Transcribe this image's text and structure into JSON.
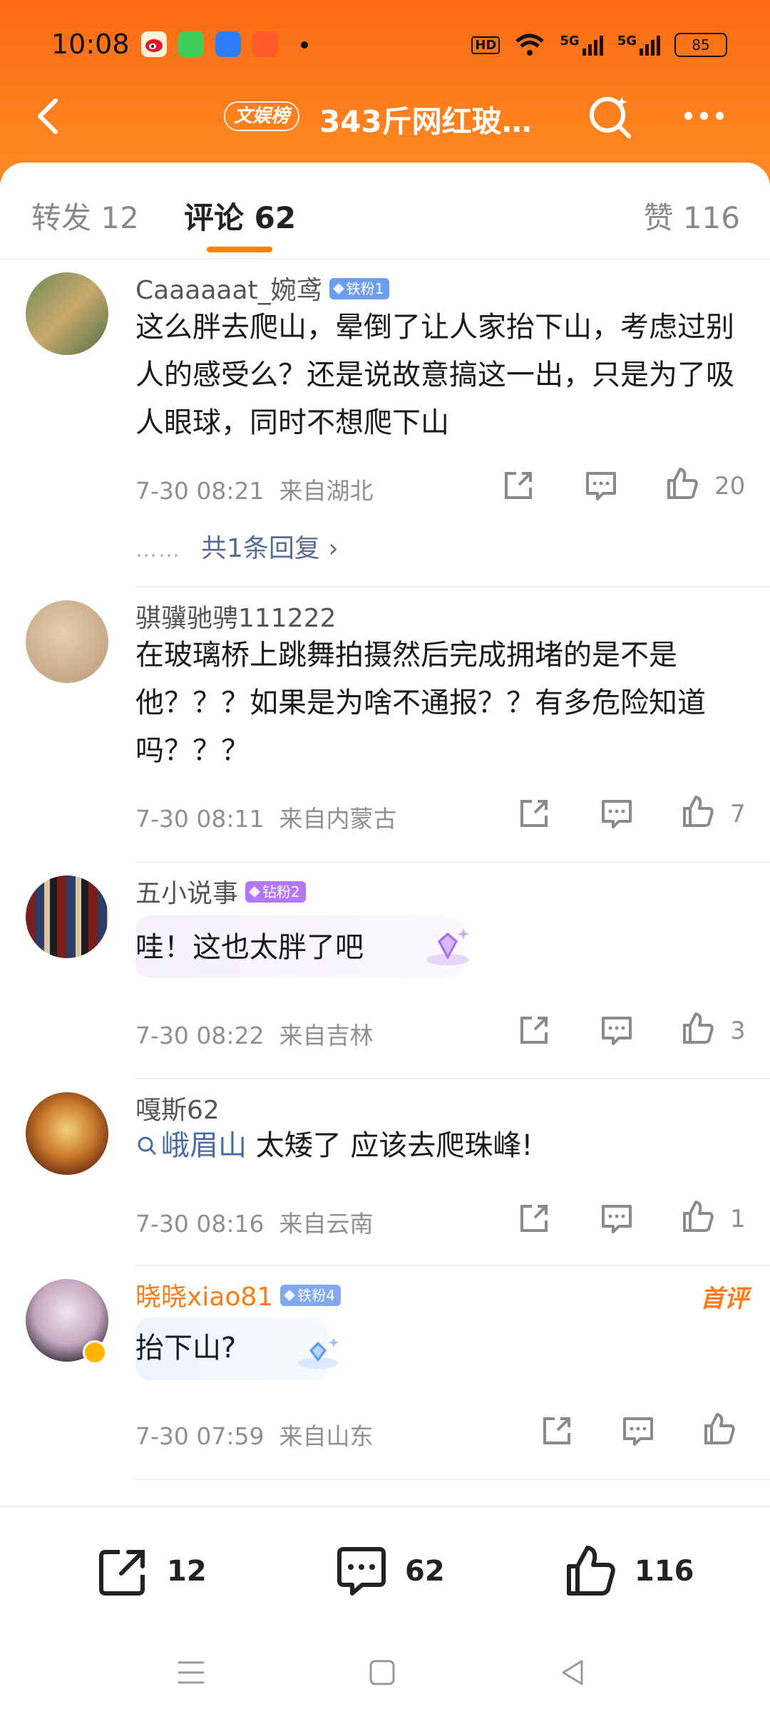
{
  "status_bar": {
    "time": "10:08",
    "hd": "HD",
    "net1": "5G",
    "net2": "5G",
    "battery": "85"
  },
  "nav": {
    "tag": "文娱榜",
    "title": "343斤网红玻…"
  },
  "tabs": {
    "repost": "转发 12",
    "comment": "评论 62",
    "like": "赞 116"
  },
  "comments": [
    {
      "user": "Caaaaaat_婉鸢",
      "badge": "铁粉1",
      "text": "这么胖去爬山，晕倒了让人家抬下山，考虑过别人的感受么？还是说故意搞这一出，只是为了吸人眼球，同时不想爬下山",
      "time": "7-30 08:21",
      "location": "来自湖北",
      "likes": "20",
      "replies_dots": "……",
      "replies": "共1条回复 ›"
    },
    {
      "user": "骐骥驰骋111222",
      "text": "在玻璃桥上跳舞拍摄然后完成拥堵的是不是他？？？如果是为啥不通报？？有多危险知道吗？？？",
      "time": "7-30 08:11",
      "location": "来自内蒙古",
      "likes": "7"
    },
    {
      "user": "五小说事",
      "badge": "钻粉2",
      "text": "哇！这也太胖了吧",
      "time": "7-30 08:22",
      "location": "来自吉林",
      "likes": "3"
    },
    {
      "user": "嘎斯62",
      "link": "峨眉山",
      "text": " 太矮了  应该去爬珠峰!",
      "time": "7-30 08:16",
      "location": "来自云南",
      "likes": "1"
    },
    {
      "user": "晓晓xiao81",
      "badge": "铁粉4",
      "first_label": "首评",
      "text": "抬下山?",
      "time": "7-30 07:59",
      "location": "来自山东"
    }
  ],
  "bottom_bar": {
    "repost": "12",
    "comment": "62",
    "like": "116"
  },
  "colors": {
    "accent": "#ff8200",
    "header": "#fb6a14",
    "link": "#576b95"
  }
}
